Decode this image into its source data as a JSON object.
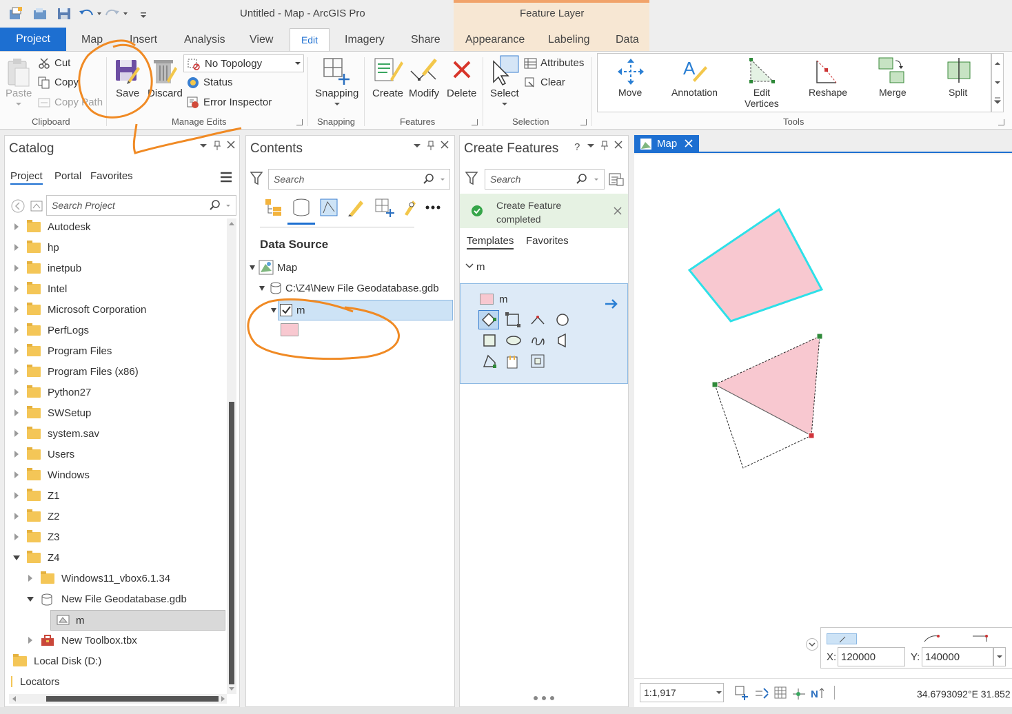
{
  "app": {
    "title": "Untitled - Map - ArcGIS Pro",
    "context_tab_group": "Feature Layer"
  },
  "tabs": {
    "project": "Project",
    "items": [
      "Map",
      "Insert",
      "Analysis",
      "View",
      "Edit",
      "Imagery",
      "Share"
    ],
    "context_items": [
      "Appearance",
      "Labeling",
      "Data"
    ]
  },
  "ribbon": {
    "clipboard": {
      "paste": "Paste",
      "cut": "Cut",
      "copy": "Copy",
      "copy_path": "Copy Path",
      "label": "Clipboard"
    },
    "manage_edits": {
      "save": "Save",
      "discard": "Discard",
      "topology": "No Topology",
      "status": "Status",
      "error_inspector": "Error Inspector",
      "label": "Manage Edits"
    },
    "snapping": {
      "snapping": "Snapping",
      "label": "Snapping"
    },
    "features": {
      "create": "Create",
      "modify": "Modify",
      "delete": "Delete",
      "label": "Features"
    },
    "selection": {
      "select": "Select",
      "attributes": "Attributes",
      "clear": "Clear",
      "label": "Selection"
    },
    "tools": {
      "move": "Move",
      "annotation": "Annotation",
      "edit_vertices_1": "Edit",
      "edit_vertices_2": "Vertices",
      "reshape": "Reshape",
      "merge": "Merge",
      "split": "Split",
      "label": "Tools"
    }
  },
  "catalog": {
    "title": "Catalog",
    "tabs": [
      "Project",
      "Portal",
      "Favorites"
    ],
    "search_placeholder": "Search Project",
    "items": [
      {
        "label": "Autodesk"
      },
      {
        "label": "hp"
      },
      {
        "label": "inetpub"
      },
      {
        "label": "Intel"
      },
      {
        "label": "Microsoft Corporation"
      },
      {
        "label": "PerfLogs"
      },
      {
        "label": "Program Files"
      },
      {
        "label": "Program Files (x86)"
      },
      {
        "label": "Python27"
      },
      {
        "label": "SWSetup"
      },
      {
        "label": "system.sav"
      },
      {
        "label": "Users"
      },
      {
        "label": "Windows"
      },
      {
        "label": "Z1"
      },
      {
        "label": "Z2"
      },
      {
        "label": "Z3"
      },
      {
        "label": "Z4"
      }
    ],
    "z4_children": {
      "windows11": "Windows11_vbox6.1.34",
      "gdb": "New File Geodatabase.gdb",
      "fc": "m",
      "toolbox": "New Toolbox.tbx"
    },
    "local_disk": "Local Disk (D:)",
    "locators": "Locators"
  },
  "contents": {
    "title": "Contents",
    "search_placeholder": "Search",
    "section": "Data Source",
    "map": "Map",
    "gdb_path": "C:\\Z4\\New File Geodatabase.gdb",
    "layer": "m"
  },
  "create_features": {
    "title": "Create Features",
    "help": "?",
    "search_placeholder": "Search",
    "message_1": "Create Feature",
    "message_2": "completed",
    "tabs": [
      "Templates",
      "Favorites"
    ],
    "group": "m",
    "template": "m"
  },
  "map": {
    "tab": "Map",
    "x_label": "X:",
    "x_value": "120000",
    "y_label": "Y:",
    "y_value": "140000",
    "scale": "1:1,917",
    "coords": "34.6793092°E 31.852"
  },
  "colors": {
    "accent": "#1d6fd1",
    "polygon_fill": "#f8c8d0",
    "selection_outline": "#2ee0e8",
    "annotation": "#f08a24"
  }
}
